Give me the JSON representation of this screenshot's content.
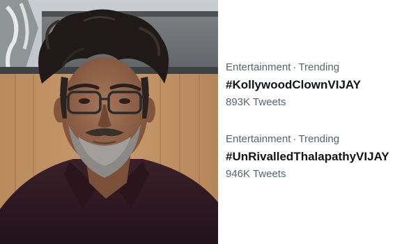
{
  "trends": [
    {
      "category": "Entertainment",
      "separator": "·",
      "status": "Trending",
      "hashtag": "#KollywoodClownVIJAY",
      "count": "893K Tweets"
    },
    {
      "category": "Entertainment",
      "separator": "·",
      "status": "Trending",
      "hashtag": "#UnRivalledThalapathyVIJAY",
      "count": "946K Tweets"
    }
  ],
  "colors": {
    "meta_text": "#536471",
    "hashtag_text": "#0f1419",
    "background": "#ffffff"
  }
}
